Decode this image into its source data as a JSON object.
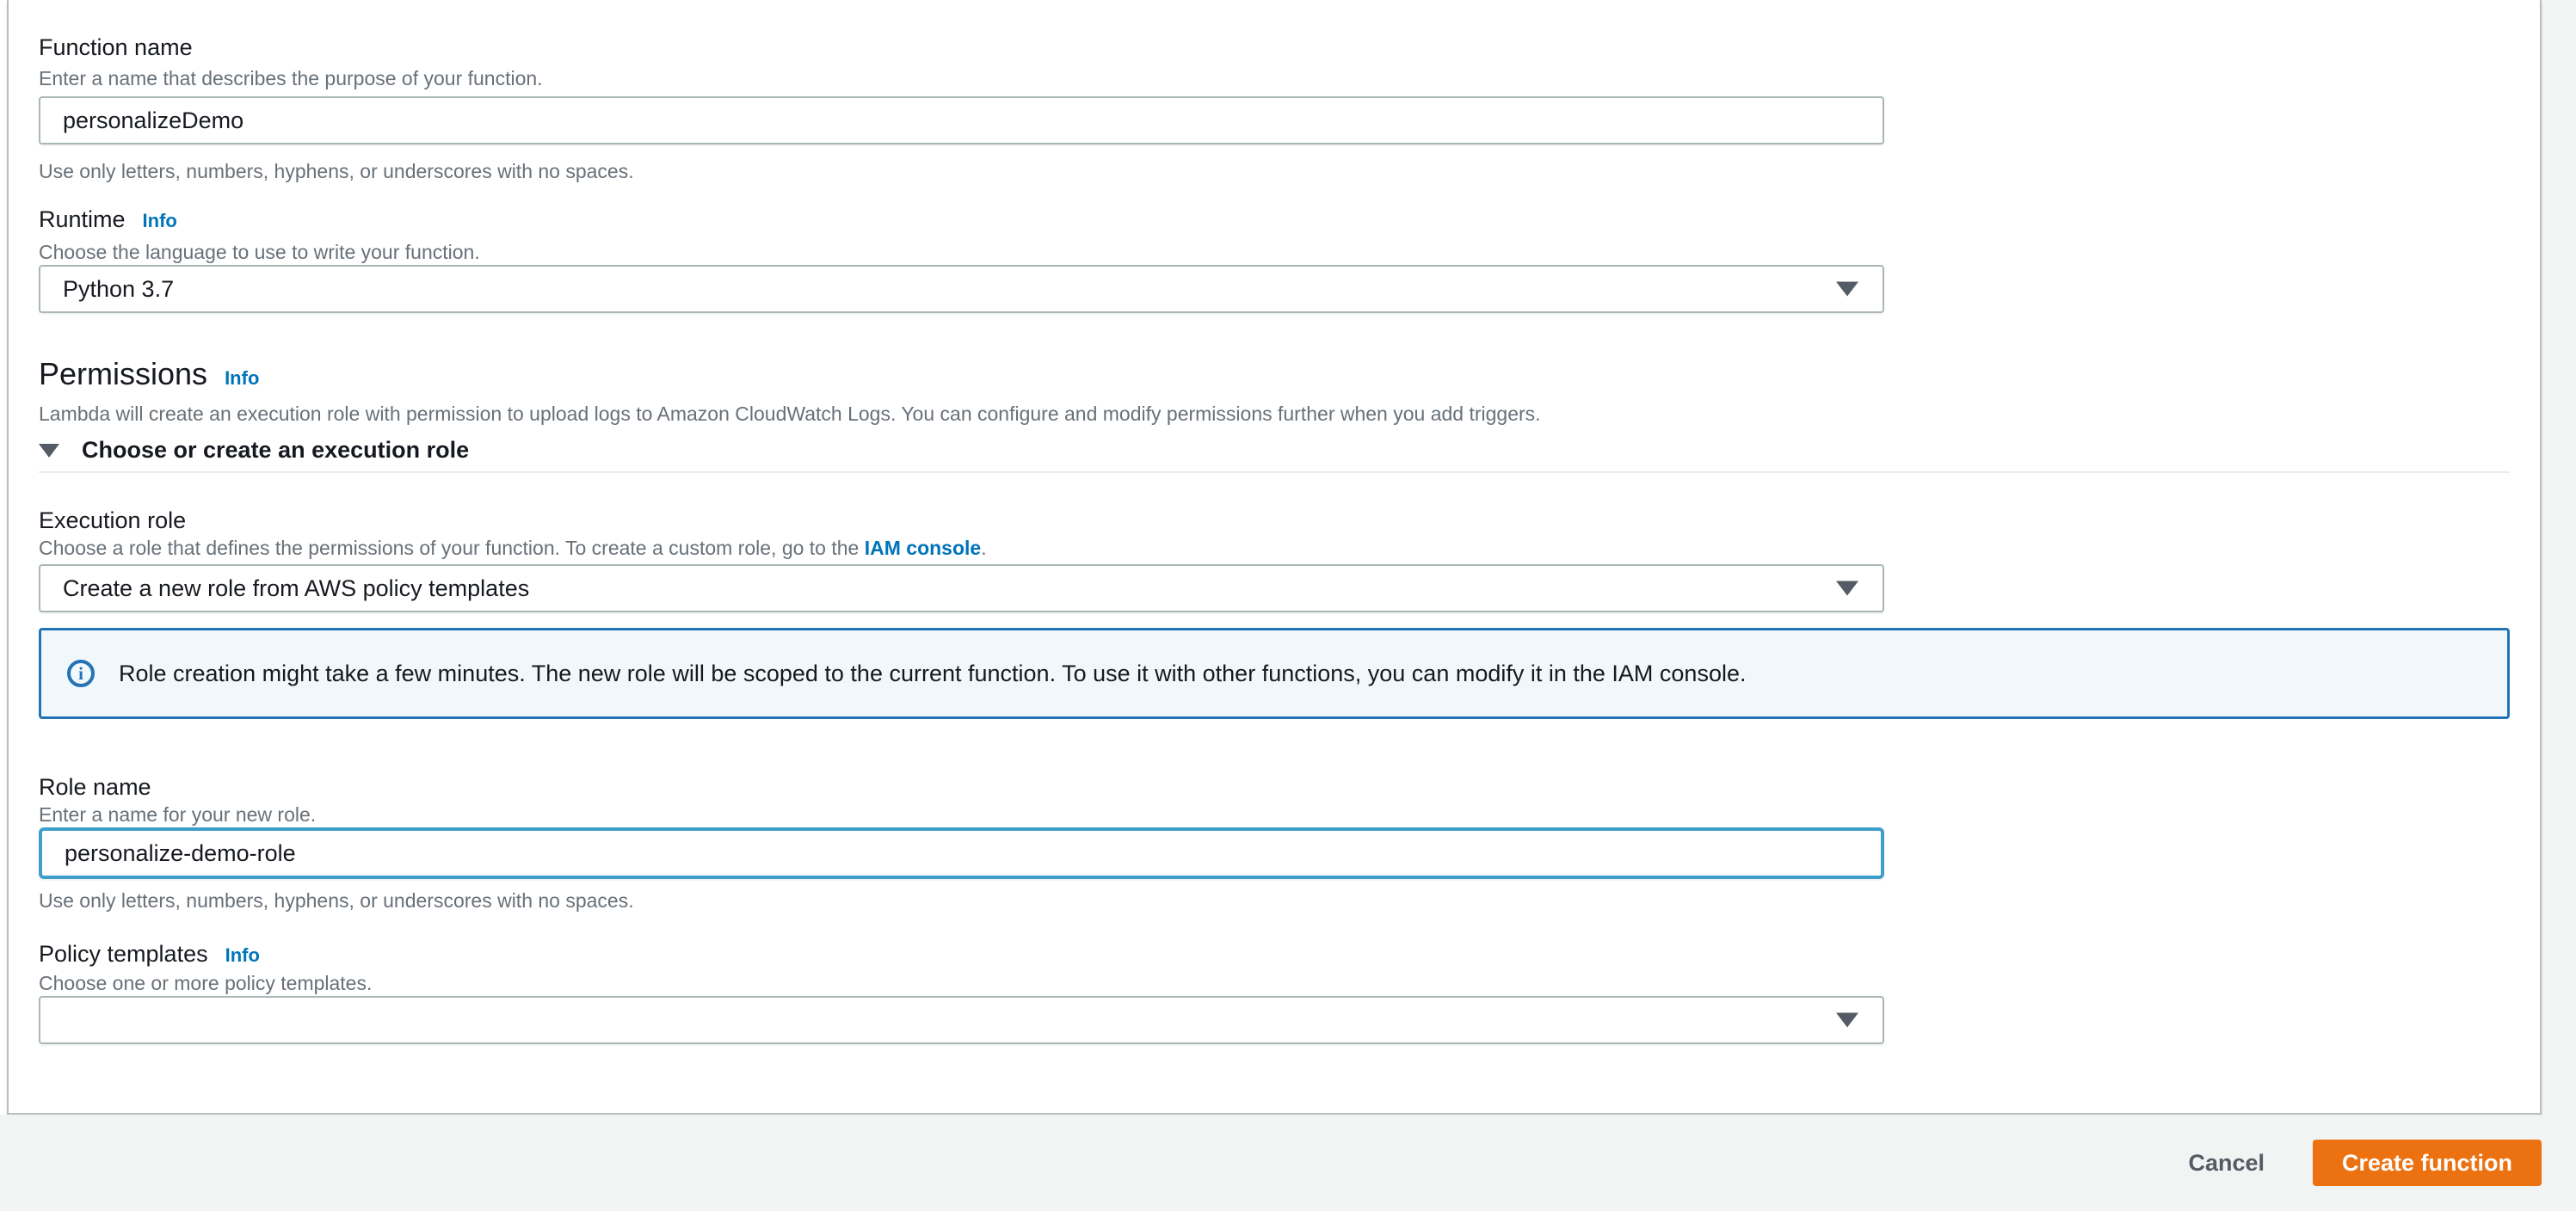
{
  "form": {
    "function_name": {
      "label": "Function name",
      "description": "Enter a name that describes the purpose of your function.",
      "value": "personalizeDemo",
      "hint": "Use only letters, numbers, hyphens, or underscores with no spaces."
    },
    "runtime": {
      "label": "Runtime",
      "info": "Info",
      "description": "Choose the language to use to write your function.",
      "value": "Python 3.7"
    },
    "permissions": {
      "heading": "Permissions",
      "info": "Info",
      "description": "Lambda will create an execution role with permission to upload logs to Amazon CloudWatch Logs. You can configure and modify permissions further when you add triggers.",
      "expander": "Choose or create an execution role"
    },
    "execution_role": {
      "label": "Execution role",
      "description_before_link": "Choose a role that defines the permissions of your function. To create a custom role, go to the ",
      "link": "IAM console",
      "description_after_link": ".",
      "value": "Create a new role from AWS policy templates"
    },
    "banner": {
      "text": "Role creation might take a few minutes. The new role will be scoped to the current function. To use it with other functions, you can modify it in the IAM console."
    },
    "role_name": {
      "label": "Role name",
      "description": "Enter a name for your new role.",
      "value": "personalize-demo-role",
      "hint": "Use only letters, numbers, hyphens, or underscores with no spaces."
    },
    "policy_templates": {
      "label": "Policy templates",
      "info": "Info",
      "description": "Choose one or more policy templates.",
      "value": ""
    }
  },
  "footer": {
    "cancel_label": "Cancel",
    "create_label": "Create function"
  },
  "colors": {
    "accent_link_blue": "#0073bb",
    "banner_border_blue": "#2373b5",
    "banner_background": "#f1f8fc",
    "focus_border_blue": "#3f9ecb",
    "primary_button_orange": "#ec7211",
    "page_background": "#f2f3f3",
    "input_border_gray": "#aab7b8",
    "text_dark": "#16191f",
    "text_gray": "#687078"
  }
}
